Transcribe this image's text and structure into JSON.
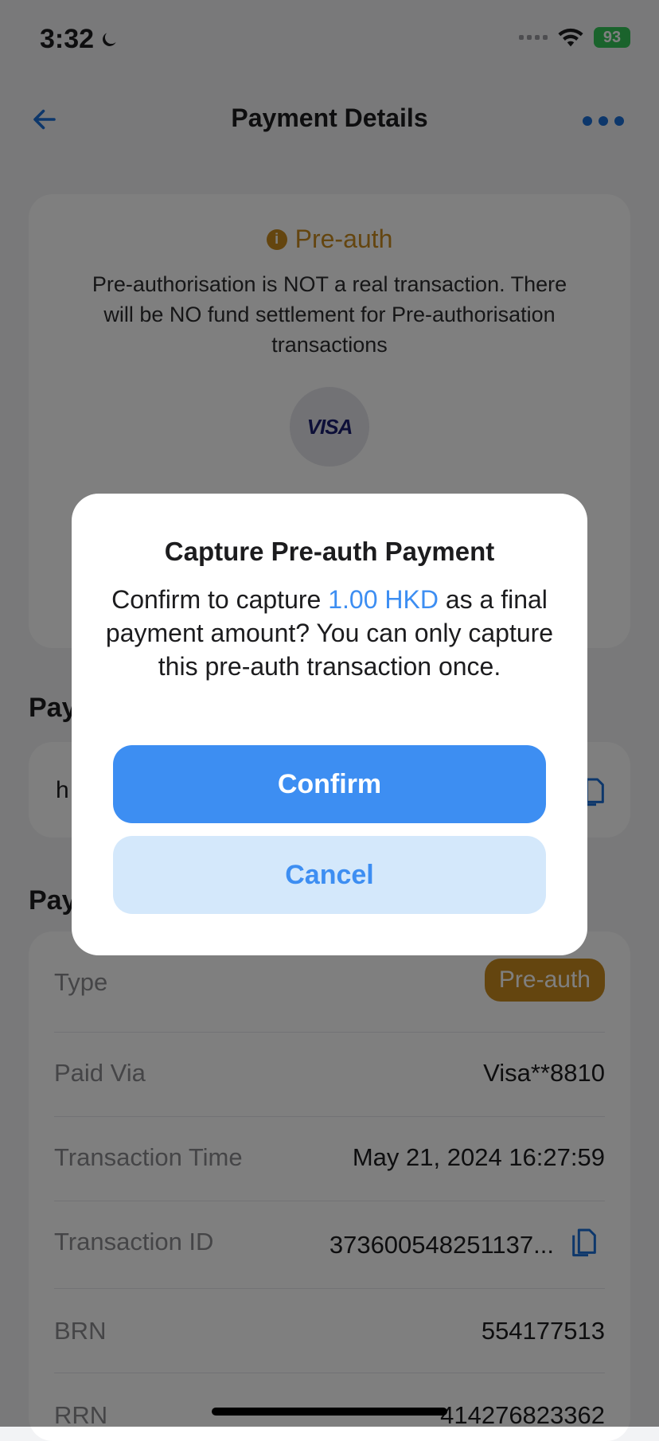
{
  "status_bar": {
    "time": "3:32",
    "battery": "93"
  },
  "header": {
    "title": "Payment Details"
  },
  "preauth_notice": {
    "label": "Pre-auth",
    "message": "Pre-authorisation is NOT a real transaction. There will be NO fund settlement for Pre-authorisation transactions",
    "card_brand": "VISA"
  },
  "sections": {
    "link_title": "Pay",
    "details_title": "Pay",
    "link_text": "h"
  },
  "details": {
    "type_label": "Type",
    "type_value": "Pre-auth",
    "paid_via_label": "Paid Via",
    "paid_via_value": "Visa**8810",
    "time_label": "Transaction Time",
    "time_value": "May 21, 2024 16:27:59",
    "txn_id_label": "Transaction ID",
    "txn_id_value": "373600548251137...",
    "brn_label": "BRN",
    "brn_value": "554177513",
    "rrn_label": "RRN",
    "rrn_value": "414276823362"
  },
  "dialog": {
    "title": "Capture Pre-auth Payment",
    "message_prefix": "Confirm to capture ",
    "amount": "1.00 HKD",
    "message_suffix": " as a final payment amount? You can only capture this pre-auth transaction once.",
    "confirm_label": "Confirm",
    "cancel_label": "Cancel"
  },
  "colors": {
    "accent": "#3d8ef2",
    "preauth": "#c98a1e",
    "cancel_bg": "#d4e8fb"
  }
}
